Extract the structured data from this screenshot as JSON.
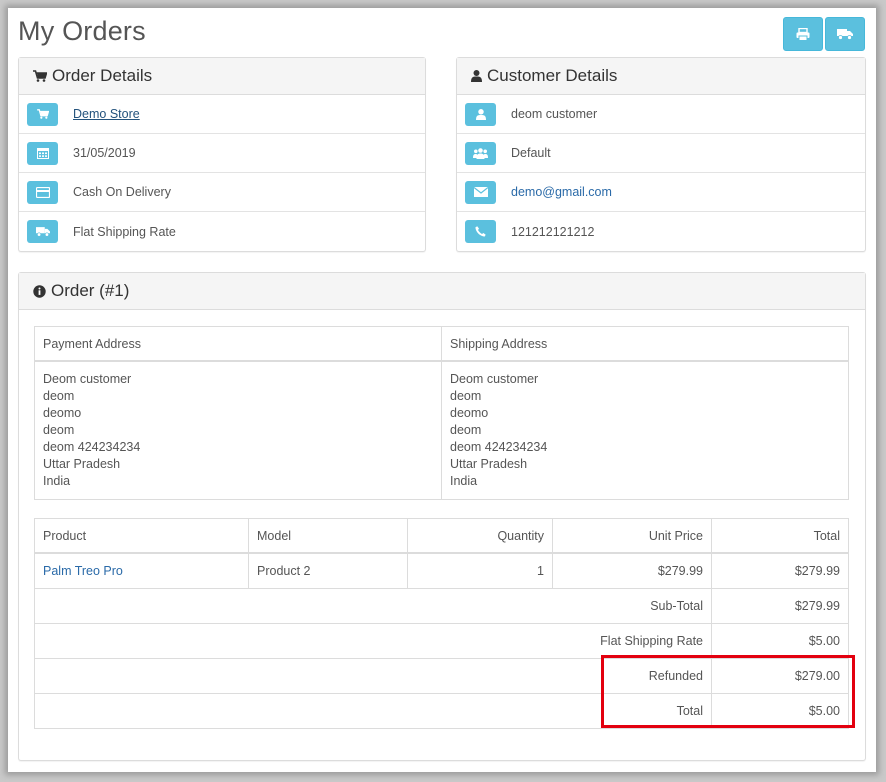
{
  "page_title": "My Orders",
  "toolbar": {
    "print_icon": "print-icon",
    "shipping_icon": "truck-icon"
  },
  "order_details": {
    "heading": "Order Details",
    "store": "Demo Store",
    "date": "31/05/2019",
    "payment_method": "Cash On Delivery",
    "shipping_method": "Flat Shipping Rate"
  },
  "customer_details": {
    "heading": "Customer Details",
    "name": "deom customer",
    "group": "Default",
    "email": "demo@gmail.com",
    "telephone": "121212121212"
  },
  "order": {
    "heading": "Order (#1)",
    "payment_address_label": "Payment Address",
    "shipping_address_label": "Shipping Address",
    "payment_address": [
      "Deom customer",
      "deom",
      "deomo",
      "deom",
      "deom 424234234",
      "Uttar Pradesh",
      "India"
    ],
    "shipping_address": [
      "Deom customer",
      "deom",
      "deomo",
      "deom",
      "deom 424234234",
      "Uttar Pradesh",
      "India"
    ],
    "columns": [
      "Product",
      "Model",
      "Quantity",
      "Unit Price",
      "Total"
    ],
    "products": [
      {
        "name": "Palm Treo Pro",
        "model": "Product 2",
        "quantity": "1",
        "unit_price": "$279.99",
        "total": "$279.99"
      }
    ],
    "totals": [
      {
        "label": "Sub-Total",
        "value": "$279.99"
      },
      {
        "label": "Flat Shipping Rate",
        "value": "$5.00"
      },
      {
        "label": "Refunded",
        "value": "$279.00"
      },
      {
        "label": "Total",
        "value": "$5.00"
      }
    ]
  },
  "colors": {
    "info_button": "#5bc0de",
    "highlight_box": "#e3000f",
    "link": "#23527c"
  }
}
